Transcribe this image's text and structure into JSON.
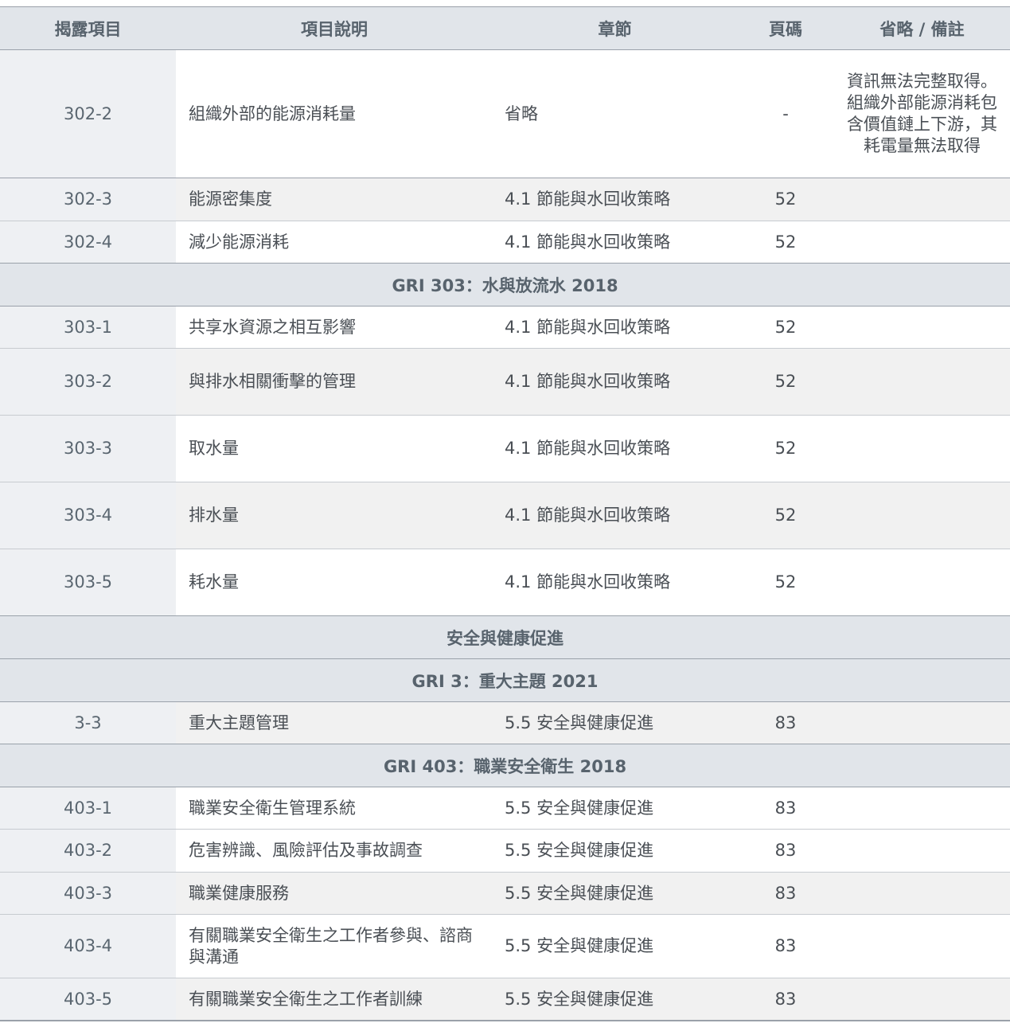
{
  "table": {
    "headers": [
      "揭露項目",
      "項目說明",
      "章節",
      "頁碼",
      "省略 / 備註"
    ],
    "rows": [
      {
        "type": "data",
        "id": "302-2",
        "desc": "組織外部的能源消耗量",
        "chapter": "省略",
        "page": "-",
        "note": "資訊無法完整取得。組織外部能源消耗包含價值鏈上下游，其耗電量無法取得"
      },
      {
        "type": "data",
        "id": "302-3",
        "desc": "能源密集度",
        "chapter": "4.1 節能與水回收策略",
        "page": "52",
        "note": ""
      },
      {
        "type": "data",
        "id": "302-4",
        "desc": "減少能源消耗",
        "chapter": "4.1 節能與水回收策略",
        "page": "52",
        "note": ""
      },
      {
        "type": "section",
        "title": "GRI 303：水與放流水 2018"
      },
      {
        "type": "data",
        "id": "303-1",
        "desc": "共享水資源之相互影響",
        "chapter": "4.1 節能與水回收策略",
        "page": "52",
        "note": ""
      },
      {
        "type": "data",
        "id": "303-2",
        "desc": "與排水相關衝擊的管理",
        "chapter": "4.1 節能與水回收策略",
        "page": "52",
        "note": ""
      },
      {
        "type": "data",
        "id": "303-3",
        "desc": "取水量",
        "chapter": "4.1 節能與水回收策略",
        "page": "52",
        "note": ""
      },
      {
        "type": "data",
        "id": "303-4",
        "desc": "排水量",
        "chapter": "4.1 節能與水回收策略",
        "page": "52",
        "note": ""
      },
      {
        "type": "data",
        "id": "303-5",
        "desc": "耗水量",
        "chapter": "4.1 節能與水回收策略",
        "page": "52",
        "note": ""
      },
      {
        "type": "section",
        "title": "安全與健康促進"
      },
      {
        "type": "section",
        "title": "GRI 3：重大主題 2021"
      },
      {
        "type": "data",
        "id": "3-3",
        "desc": "重大主題管理",
        "chapter": "5.5 安全與健康促進",
        "page": "83",
        "note": ""
      },
      {
        "type": "section",
        "title": "GRI 403：職業安全衛生 2018"
      },
      {
        "type": "data",
        "id": "403-1",
        "desc": "職業安全衛生管理系統",
        "chapter": "5.5 安全與健康促進",
        "page": "83",
        "note": ""
      },
      {
        "type": "data",
        "id": "403-2",
        "desc": "危害辨識、風險評估及事故調查",
        "chapter": "5.5 安全與健康促進",
        "page": "83",
        "note": ""
      },
      {
        "type": "data",
        "id": "403-3",
        "desc": "職業健康服務",
        "chapter": "5.5 安全與健康促進",
        "page": "83",
        "note": ""
      },
      {
        "type": "data",
        "id": "403-4",
        "desc": "有關職業安全衛生之工作者參與、諮商與溝通",
        "chapter": "5.5 安全與健康促進",
        "page": "83",
        "note": ""
      },
      {
        "type": "data",
        "id": "403-5",
        "desc": "有關職業安全衛生之工作者訓練",
        "chapter": "5.5 安全與健康促進",
        "page": "83",
        "note": ""
      }
    ]
  }
}
